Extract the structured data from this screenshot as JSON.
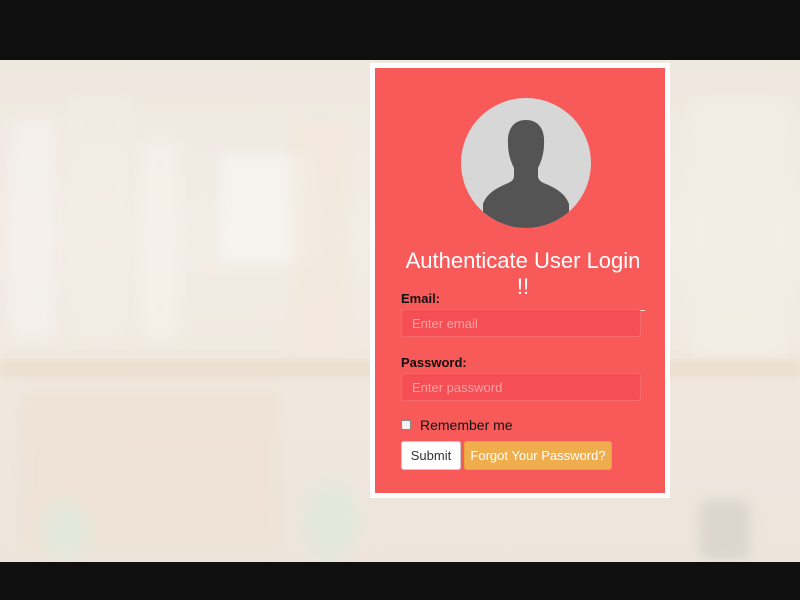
{
  "login": {
    "title": "Authenticate User Login !!",
    "email_label": "Email:",
    "email_placeholder": "Enter email",
    "email_value": "",
    "password_label": "Password:",
    "password_placeholder": "Enter password",
    "password_value": "",
    "remember_label": "Remember me",
    "remember_checked": false,
    "submit_label": "Submit",
    "forgot_label": "Forgot Your Password?",
    "avatar_icon": "user-silhouette-icon"
  },
  "colors": {
    "card_bg": "#f85a5a",
    "card_border": "#ffffff",
    "input_bg": "#f54e55",
    "forgot_button": "#f0ad4e",
    "submit_button": "#ffffff",
    "letterbox": "#0f0f10"
  }
}
